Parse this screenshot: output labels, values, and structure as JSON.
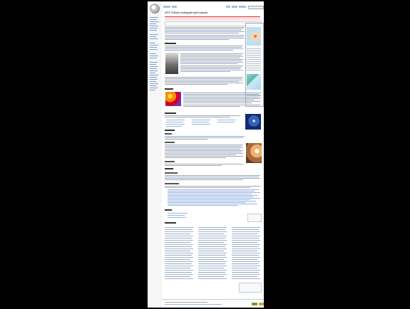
{
  "article": {
    "title": "2011 Tohoku earthquake and tsunami"
  }
}
